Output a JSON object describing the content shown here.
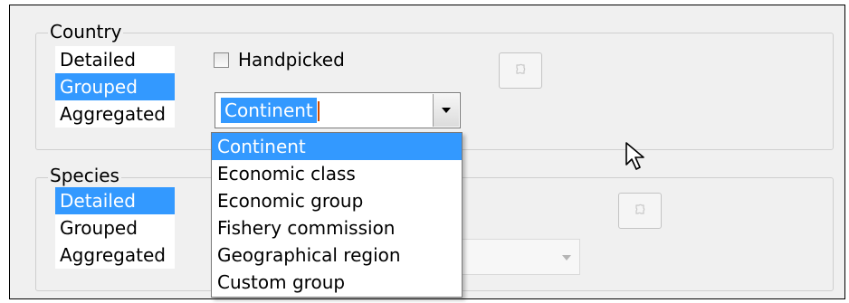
{
  "country": {
    "legend": "Country",
    "levels": [
      "Detailed",
      "Grouped",
      "Aggregated"
    ],
    "selected_level": "Grouped",
    "handpicked_label": "Handpicked",
    "handpicked_checked": false,
    "grouping_value": "Continent"
  },
  "species": {
    "legend": "Species",
    "levels": [
      "Detailed",
      "Grouped",
      "Aggregated"
    ],
    "selected_level": "Detailed"
  },
  "dropdown": {
    "options": [
      "Continent",
      "Economic class",
      "Economic group",
      "Fishery commission",
      "Geographical region",
      "Custom group"
    ],
    "selected": "Continent"
  },
  "colors": {
    "selection": "#3399ff",
    "panel": "#f0f0f0"
  },
  "icons": [
    "puzzle-icon",
    "dropdown-arrow-icon",
    "mouse-pointer-icon"
  ]
}
